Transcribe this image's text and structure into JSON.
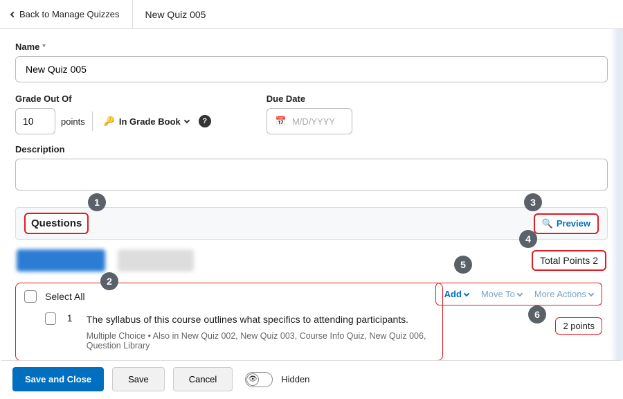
{
  "topbar": {
    "back_label": "Back to Manage Quizzes",
    "title": "New Quiz 005"
  },
  "fields": {
    "name_label": "Name",
    "name_req": "*",
    "name_value": "New Quiz 005",
    "grade_label": "Grade Out Of",
    "grade_value": "10",
    "points_label": "points",
    "gradebook_label": "In Grade Book",
    "due_label": "Due Date",
    "due_placeholder": "M/D/YYYY",
    "desc_label": "Description"
  },
  "questions": {
    "section_title": "Questions",
    "preview_label": "Preview",
    "total_points_label": "Total Points 2",
    "select_all_label": "Select All",
    "toolbar": {
      "add": "Add",
      "move": "Move To",
      "more": "More Actions"
    },
    "q1": {
      "num": "1",
      "text": "The syllabus of this course outlines what specifics to attending participants.",
      "meta": "Multiple Choice   •   Also in New Quiz 002, New Quiz 003, Course Info Quiz, New Quiz 006, Question Library",
      "points": "2 points"
    }
  },
  "footer": {
    "save_close": "Save and Close",
    "save": "Save",
    "cancel": "Cancel",
    "visibility": "Hidden"
  },
  "callouts": {
    "c1": "1",
    "c2": "2",
    "c3": "3",
    "c4": "4",
    "c5": "5",
    "c6": "6"
  }
}
